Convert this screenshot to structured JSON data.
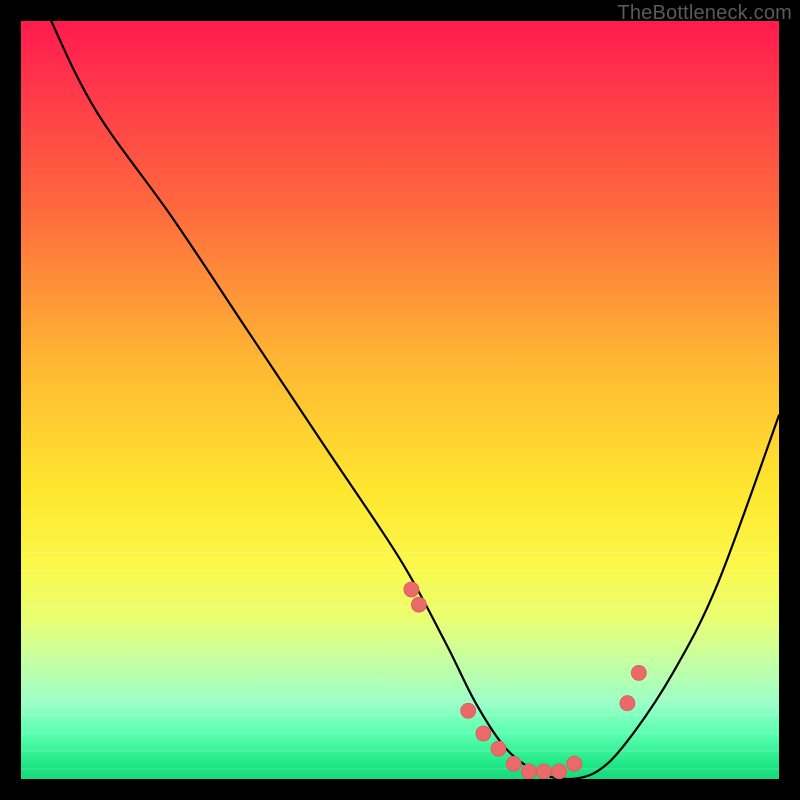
{
  "attribution": "TheBottleneck.com",
  "colors": {
    "curve_stroke": "#000000",
    "marker_fill": "#ea6a6a",
    "marker_stroke": "#d85a5a",
    "frame": "#000000"
  },
  "chart_data": {
    "type": "line",
    "title": "",
    "xlabel": "",
    "ylabel": "",
    "xlim": [
      0,
      100
    ],
    "ylim": [
      0,
      100
    ],
    "x": [
      0,
      4,
      10,
      20,
      30,
      40,
      50,
      56,
      60,
      64,
      68,
      72,
      76,
      80,
      86,
      92,
      100
    ],
    "values": [
      110,
      100,
      88,
      74,
      59,
      44,
      29,
      18,
      10,
      4,
      1,
      0,
      1,
      5,
      14,
      26,
      48
    ],
    "markers": {
      "x": [
        51.5,
        52.5,
        59,
        61,
        63,
        65,
        67,
        69,
        71,
        73,
        80,
        81.5
      ],
      "y": [
        25,
        23,
        9,
        6,
        4,
        2,
        1,
        1,
        1,
        2,
        10,
        14
      ]
    }
  }
}
